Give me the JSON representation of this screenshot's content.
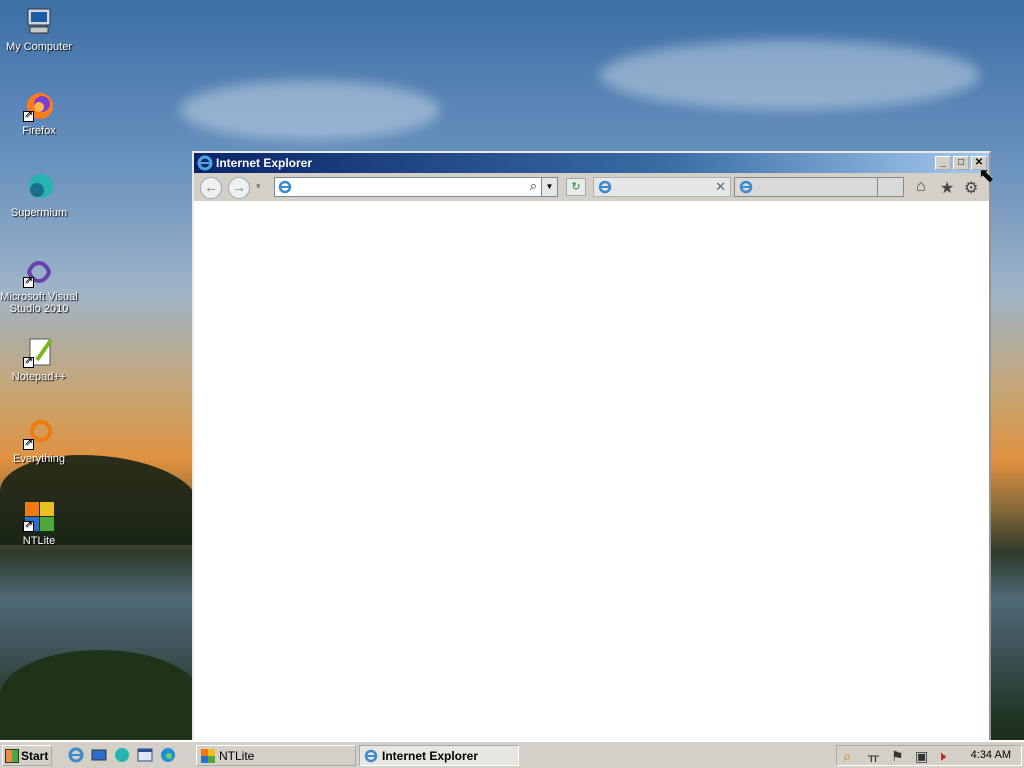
{
  "desktop": {
    "icons": [
      {
        "label": "My Computer",
        "icon": "my-computer-icon"
      },
      {
        "label": "Firefox",
        "icon": "firefox-icon"
      },
      {
        "label": "Supermium",
        "icon": "supermium-icon"
      },
      {
        "label": "Microsoft Visual Studio 2010",
        "icon": "visual-studio-icon"
      },
      {
        "label": "Notepad++",
        "icon": "notepadpp-icon"
      },
      {
        "label": "Everything",
        "icon": "everything-icon"
      },
      {
        "label": "NTLite",
        "icon": "ntlite-icon"
      }
    ]
  },
  "window": {
    "title": "Internet Explorer",
    "address_value": "",
    "tab1_title": "",
    "tab2_title": ""
  },
  "taskbar": {
    "start_label": "Start",
    "tasks": [
      {
        "label": "NTLite",
        "active": false
      },
      {
        "label": "Internet Explorer",
        "active": true
      }
    ],
    "clock": "4:34 AM"
  }
}
